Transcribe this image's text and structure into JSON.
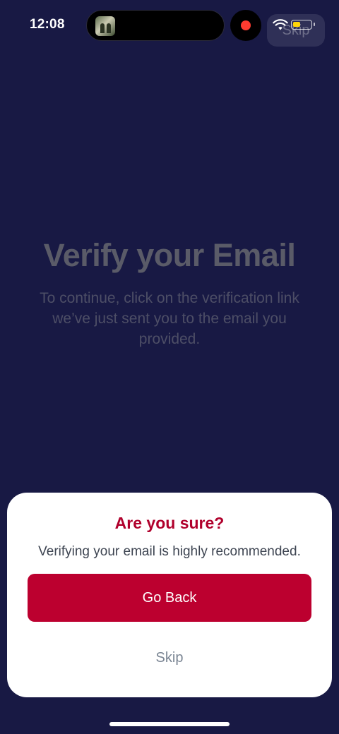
{
  "status_bar": {
    "time": "12:08",
    "wifi_icon": "wifi-icon",
    "battery_icon": "battery-icon",
    "battery_fill_color": "#ffd60a",
    "recording_dot_color": "#ff3b30"
  },
  "header": {
    "skip_label": "Skip"
  },
  "main": {
    "title": "Verify your Email",
    "subtitle": "To continue, click on the verification link we’ve just sent you to the email you provided."
  },
  "dialog": {
    "title": "Are you sure?",
    "message": "Verifying your email is highly recommended.",
    "primary_button": "Go Back",
    "secondary_button": "Skip"
  },
  "colors": {
    "background": "#181944",
    "accent": "#bc002f",
    "title_accent": "#b0002c"
  }
}
